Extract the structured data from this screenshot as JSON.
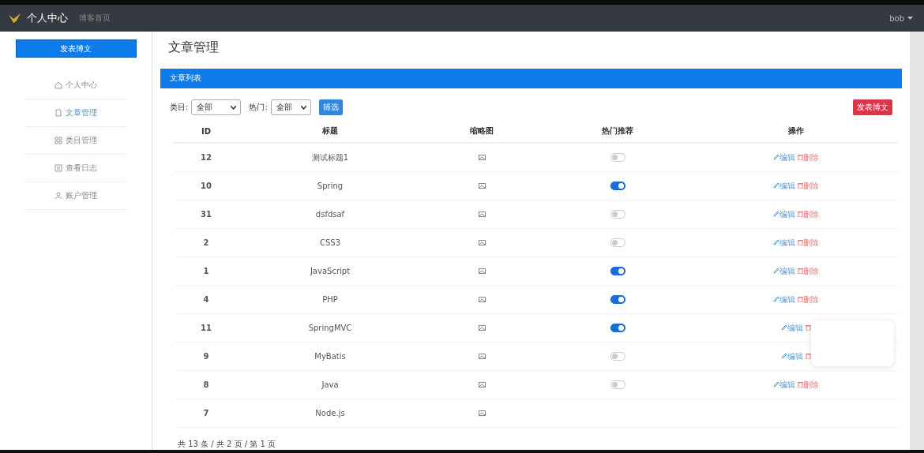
{
  "navbar": {
    "brand": "个人中心",
    "links": [
      "博客首页"
    ],
    "user": "bob"
  },
  "sidebar": {
    "button": "发表博文",
    "items": [
      {
        "label": "个人中心",
        "selected": false
      },
      {
        "label": "文章管理",
        "selected": true
      },
      {
        "label": "类目管理",
        "selected": false
      },
      {
        "label": "查看日志",
        "selected": false
      },
      {
        "label": "账户管理",
        "selected": false
      }
    ]
  },
  "page_title": "文章管理",
  "panel": {
    "title": "文章列表",
    "filters": [
      {
        "label": "类目:",
        "value": "全部"
      },
      {
        "label": "热门:",
        "value": "全部"
      }
    ],
    "filter_button": "筛选",
    "new_button": "发表博文",
    "table": {
      "columns": [
        "ID",
        "标题",
        "缩略图",
        "热门推荐",
        "操作"
      ],
      "rows": [
        {
          "id": "12",
          "title": "测试标题1",
          "hot": false,
          "edit": "编辑",
          "delete": "删除"
        },
        {
          "id": "10",
          "title": "Spring",
          "hot": true,
          "edit": "编辑",
          "delete": "删除"
        },
        {
          "id": "31",
          "title": "dsfdsaf",
          "hot": false,
          "edit": "编辑",
          "delete": "删除"
        },
        {
          "id": "2",
          "title": "CSS3",
          "hot": false,
          "edit": "编辑",
          "delete": "删除"
        },
        {
          "id": "1",
          "title": "JavaScript",
          "hot": true,
          "edit": "编辑",
          "delete": "删除"
        },
        {
          "id": "4",
          "title": "PHP",
          "hot": true,
          "edit": "编辑",
          "delete": "删除"
        },
        {
          "id": "11",
          "title": "SpringMVC",
          "hot": true,
          "edit": "编辑"
        },
        {
          "id": "9",
          "title": "MyBatis",
          "hot": false,
          "edit": "编辑"
        },
        {
          "id": "8",
          "title": "Java",
          "hot": false,
          "edit": "编辑",
          "delete": "删除"
        },
        {
          "id": "7",
          "title": "Node.js"
        }
      ]
    }
  },
  "pagination": "共 13 条 / 共 2 页 / 第 1 页"
}
